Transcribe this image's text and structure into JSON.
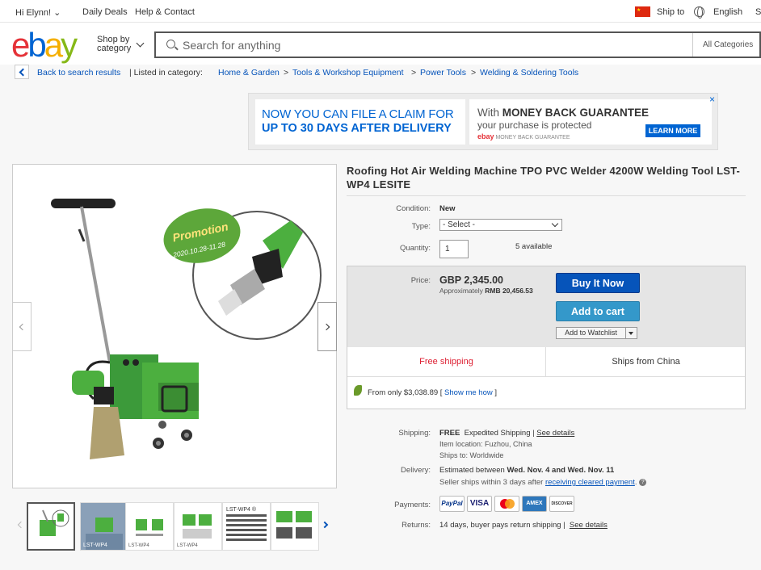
{
  "topbar": {
    "greeting": "Hi Elynn!",
    "daily_deals": "Daily Deals",
    "help_contact": "Help & Contact",
    "ship_to": "Ship to",
    "language": "English",
    "cut_off": "S"
  },
  "header": {
    "logo": {
      "e": "e",
      "b": "b",
      "a": "a",
      "y": "y"
    },
    "shop_by_line1": "Shop by",
    "shop_by_line2": "category",
    "search_placeholder": "Search for anything",
    "category_select": "All Categories"
  },
  "breadcrumb": {
    "back_label": "Back to search results",
    "listed_in": "| Listed in category:",
    "items": [
      "Home & Garden",
      "Tools & Workshop Equipment",
      "Power Tools",
      "Welding & Soldering Tools"
    ],
    "sep": ">"
  },
  "ad": {
    "line1": "NOW YOU CAN FILE A CLAIM FOR",
    "line2": "UP TO 30 DAYS AFTER  DELIVERY",
    "mbg_prefix": "With ",
    "mbg_bold": "MONEY BACK GUARANTEE",
    "mbg_sub": "your purchase is protected",
    "mbg_brand": "ebay",
    "mbg_small": "MONEY BACK GUARANTEE",
    "learn_more": "LEARN MORE",
    "close": "×"
  },
  "gallery": {
    "promo_text": "Promotion",
    "promo_dates": "2020.10.28-11.28",
    "thumb_labels": [
      "",
      "LST-WP4",
      "LST-WP4",
      "LST-WP4",
      "LST-WP4 ®",
      ""
    ]
  },
  "product": {
    "title": "Roofing Hot Air Welding Machine TPO PVC Welder 4200W Welding Tool LST-WP4 LESITE",
    "condition_label": "Condition:",
    "condition_value": "New",
    "type_label": "Type:",
    "type_value": "- Select -",
    "quantity_label": "Quantity:",
    "quantity_value": "1",
    "available": "5 available",
    "price_label": "Price:",
    "price": "GBP 2,345.00",
    "approx_prefix": "Approximately ",
    "approx_value": "RMB 20,456.53",
    "buy_now": "Buy It Now",
    "add_to_cart": "Add to cart",
    "add_to_watchlist": "Add to Watchlist",
    "free_shipping": "Free shipping",
    "ships_from": "Ships from China",
    "from_only": "From only $3,038.89 [",
    "show_me_how": " Show me how",
    "from_only_end": " ]"
  },
  "shipping": {
    "shipping_label": "Shipping:",
    "shipping_free": "FREE",
    "shipping_method": "Expedited Shipping |",
    "see_details": "See details",
    "item_location": "Item location:  Fuzhou, China",
    "ships_to": "Ships to:  Worldwide",
    "delivery_label": "Delivery:",
    "delivery_prefix": "Estimated between ",
    "delivery_dates": "Wed. Nov. 4 and Wed. Nov. 11",
    "seller_ships": "Seller ships within 3 days after ",
    "receiving_cleared": "receiving cleared payment",
    "seller_ships_end": ".",
    "help": "?",
    "payments_label": "Payments:",
    "payments": [
      "PayPal",
      "VISA",
      "",
      "AMEX",
      "DISCOVER"
    ],
    "returns_label": "Returns:",
    "returns_text": "14 days, buyer pays return shipping |",
    "returns_link": "See details"
  }
}
